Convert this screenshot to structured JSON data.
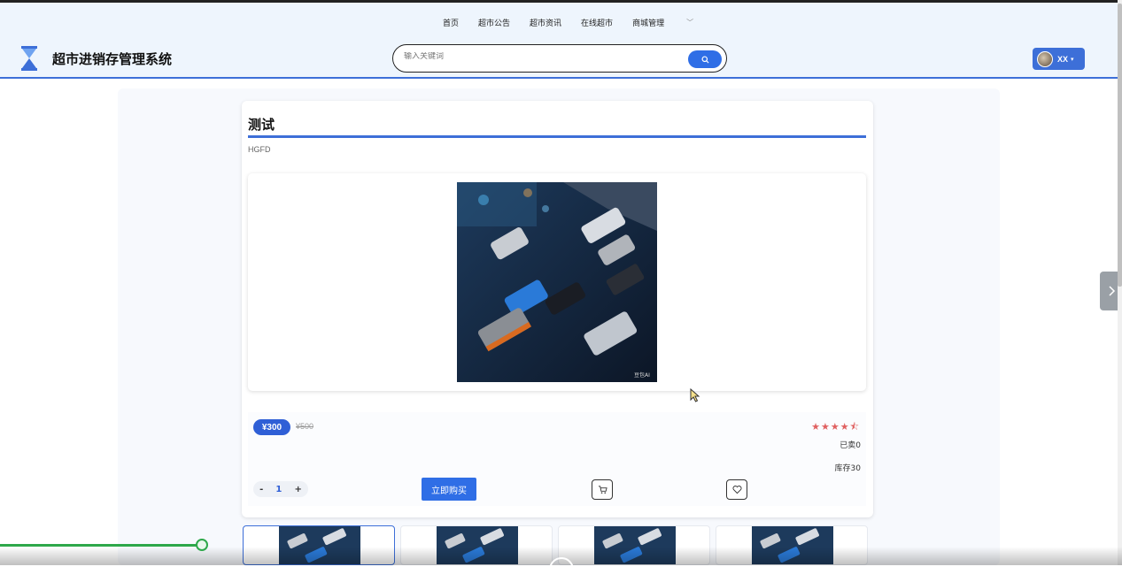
{
  "header": {
    "site_title": "超市进销存管理系统",
    "nav": [
      "首页",
      "超市公告",
      "超市资讯",
      "在线超市",
      "商城管理"
    ],
    "search_placeholder": "输入关键词",
    "user_name": "XX"
  },
  "product": {
    "title": "测试",
    "subtitle": "HGFD",
    "price": "¥300",
    "old_price": "¥500",
    "stars": "★★★★⯪",
    "rating": 4.5,
    "sold_label": "已卖0",
    "stock_label": "库存30",
    "quantity": "1",
    "qty_minus": "-",
    "qty_plus": "+",
    "buy_label": "立即购买",
    "image_watermark": "豆包AI"
  },
  "thumbnails_count": 4,
  "video_progress": 0.18,
  "colors": {
    "accent": "#3d6fd8",
    "button": "#2f6ee6",
    "header_bg": "#eef5fd",
    "star": "#e06060",
    "progress": "#2ea84a"
  },
  "icons": [
    "hourglass-logo-icon",
    "search-icon",
    "chevron-down-icon",
    "cart-icon",
    "heart-icon",
    "chevron-right-icon"
  ]
}
